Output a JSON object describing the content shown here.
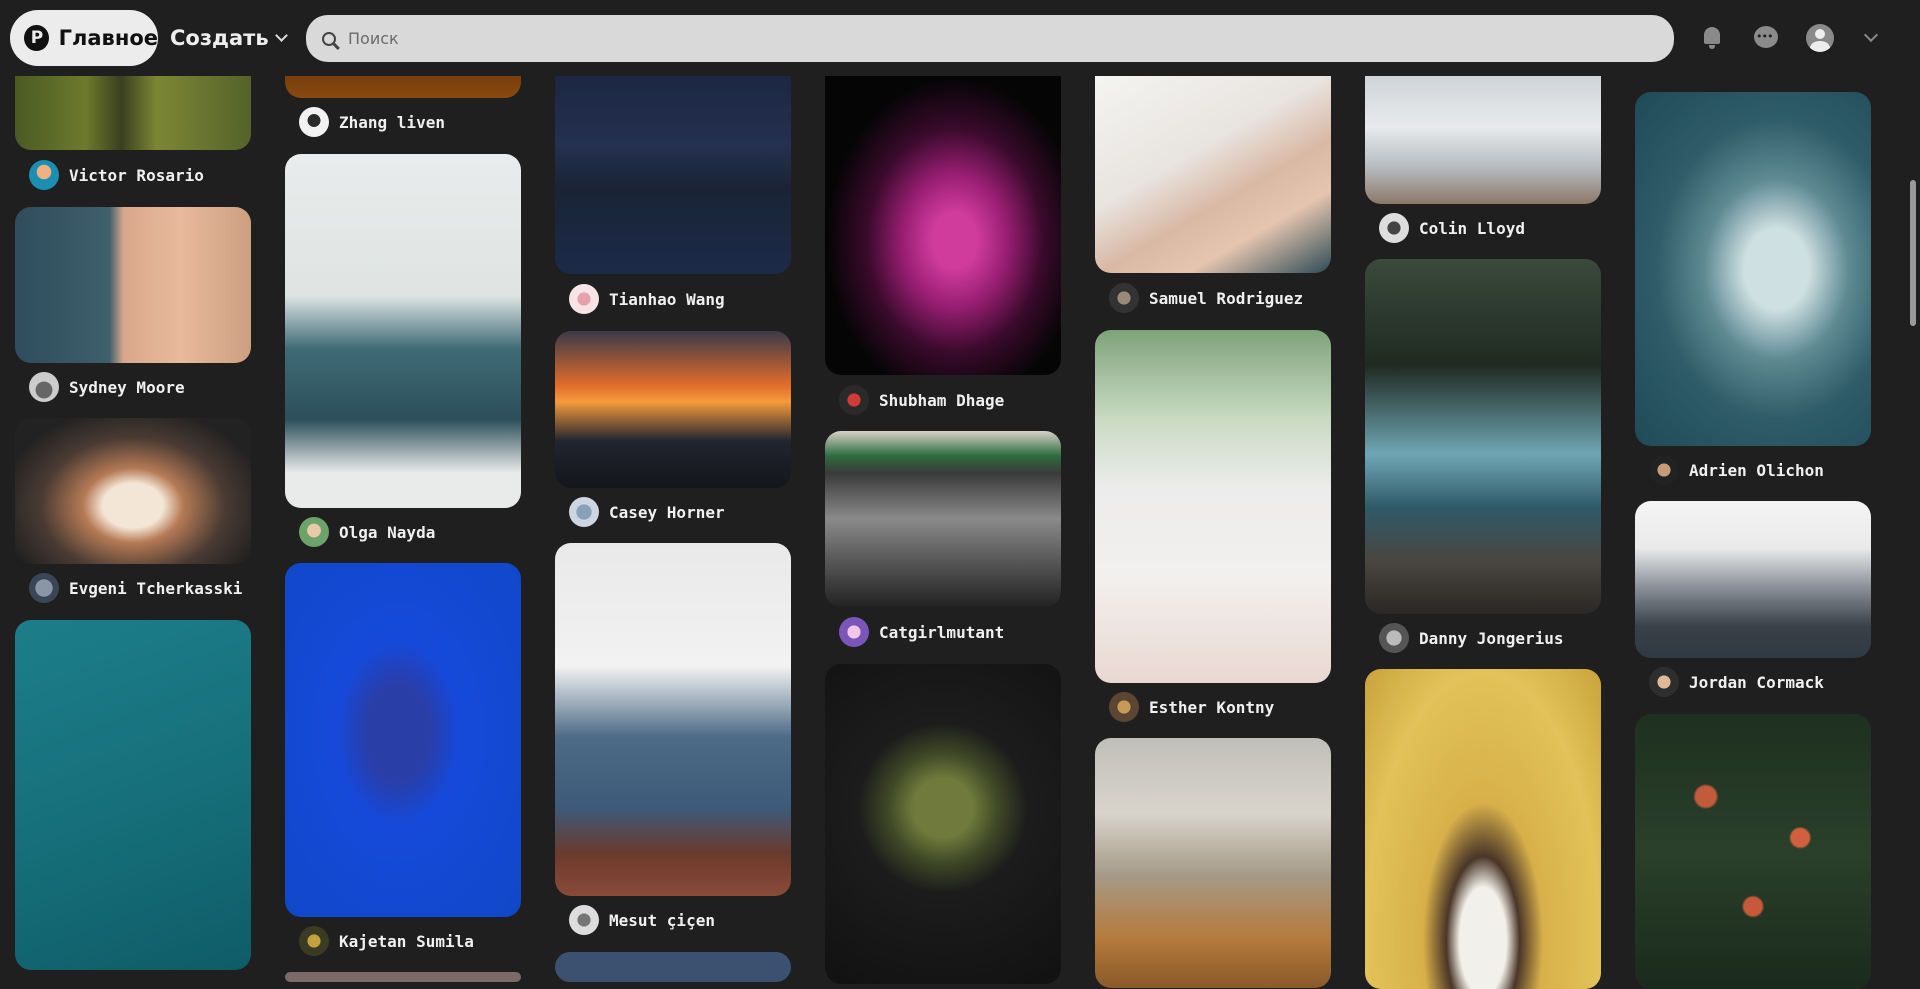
{
  "header": {
    "home_label": "Главное",
    "create_label": "Создать",
    "search_placeholder": "Поиск"
  },
  "authors": {
    "c1_1": "Victor Rosario",
    "c1_2": "Sydney Moore",
    "c1_3": "Evgeni Tcherkasski",
    "c2_1": "Zhang liven",
    "c2_2": "Olga Nayda",
    "c2_3": "Kajetan Sumila",
    "c3_1": "Tianhao Wang",
    "c3_2": "Casey Horner",
    "c3_3": "Mesut çiçen",
    "c4_1": "Shubham Dhage",
    "c4_2": "Catgirlmutant",
    "c5_1": "Samuel Rodriguez",
    "c5_2": "Esther Kontny",
    "c6_1": "Colin Lloyd",
    "c6_2": "Danny Jongerius",
    "c7_1": "Adrien Olichon",
    "c7_2": "Jordan Cormack"
  },
  "images": {
    "c1_1": "aerial-vineyard-image",
    "c1_2": "door-shadow-image",
    "c1_3": "tunnel-light-trails-image",
    "c1_4": "blossom-branches-sky-image",
    "c2_1": "orange-top-image",
    "c2_2": "man-laptop-image",
    "c2_3": "blue-face-image",
    "c3_1": "snowy-night-road-image",
    "c3_2": "sunset-cliffs-image",
    "c3_3": "white-shirt-jeans-image",
    "c4_1": "pink-spiral-image",
    "c4_2": "metro-escalator-image",
    "c4_3": "moss-sphere-image",
    "c5_1": "wedding-hands-image",
    "c5_2": "coffee-table-image",
    "c5_3": "squirrel-autumn-image",
    "c6_1": "snowy-street-image",
    "c6_2": "waterfall-image",
    "c6_3": "smiling-woman-yellow-image",
    "c7_1": "ocean-waves-image",
    "c7_2": "snowy-mountains-image",
    "c7_3": "red-flowers-bush-image"
  }
}
